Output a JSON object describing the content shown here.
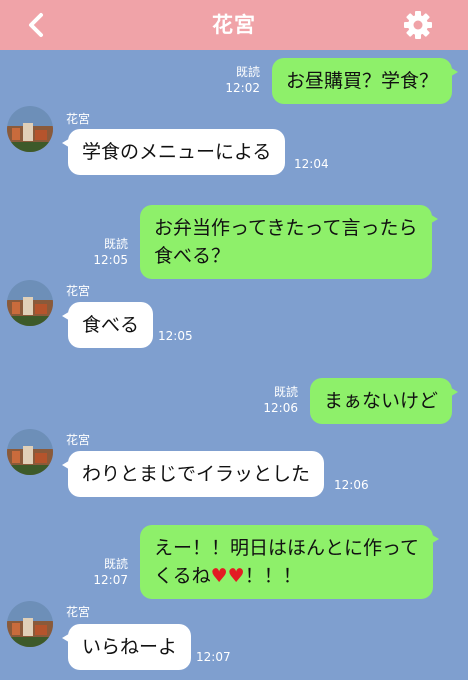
{
  "header": {
    "title": "花宮",
    "back_icon": "chevron-left-icon",
    "settings_icon": "gear-icon"
  },
  "messages": [
    {
      "dir": "out",
      "text": "お昼購買？学食？",
      "read": "既読",
      "time": "12:02"
    },
    {
      "dir": "in",
      "sender": "花宮",
      "text": "学食のメニューによる",
      "time": "12:04"
    },
    {
      "dir": "out",
      "text_line1": "お弁当作ってきたって言ったら",
      "text_line2": "食べる？",
      "read": "既読",
      "time": "12:05"
    },
    {
      "dir": "in",
      "sender": "花宮",
      "text": "食べる",
      "time": "12:05"
    },
    {
      "dir": "out",
      "text": "まぁないけど",
      "read": "既読",
      "time": "12:06"
    },
    {
      "dir": "in",
      "sender": "花宮",
      "text": "わりとまじでイラッとした",
      "time": "12:06"
    },
    {
      "dir": "out",
      "text_line1": "えー！！明日はほんとに作って",
      "text_line2_a": "くるね",
      "hearts": "♥♥",
      "text_line2_b": "！！！",
      "read": "既読",
      "time": "12:07"
    },
    {
      "dir": "in",
      "sender": "花宮",
      "text": "いらねーよ",
      "time": "12:07"
    }
  ],
  "colors": {
    "background": "#7f9fcf",
    "header": "#f0a3a8",
    "outgoing_bubble": "#8ef06a",
    "incoming_bubble": "#ffffff",
    "heart": "#e31b23"
  }
}
